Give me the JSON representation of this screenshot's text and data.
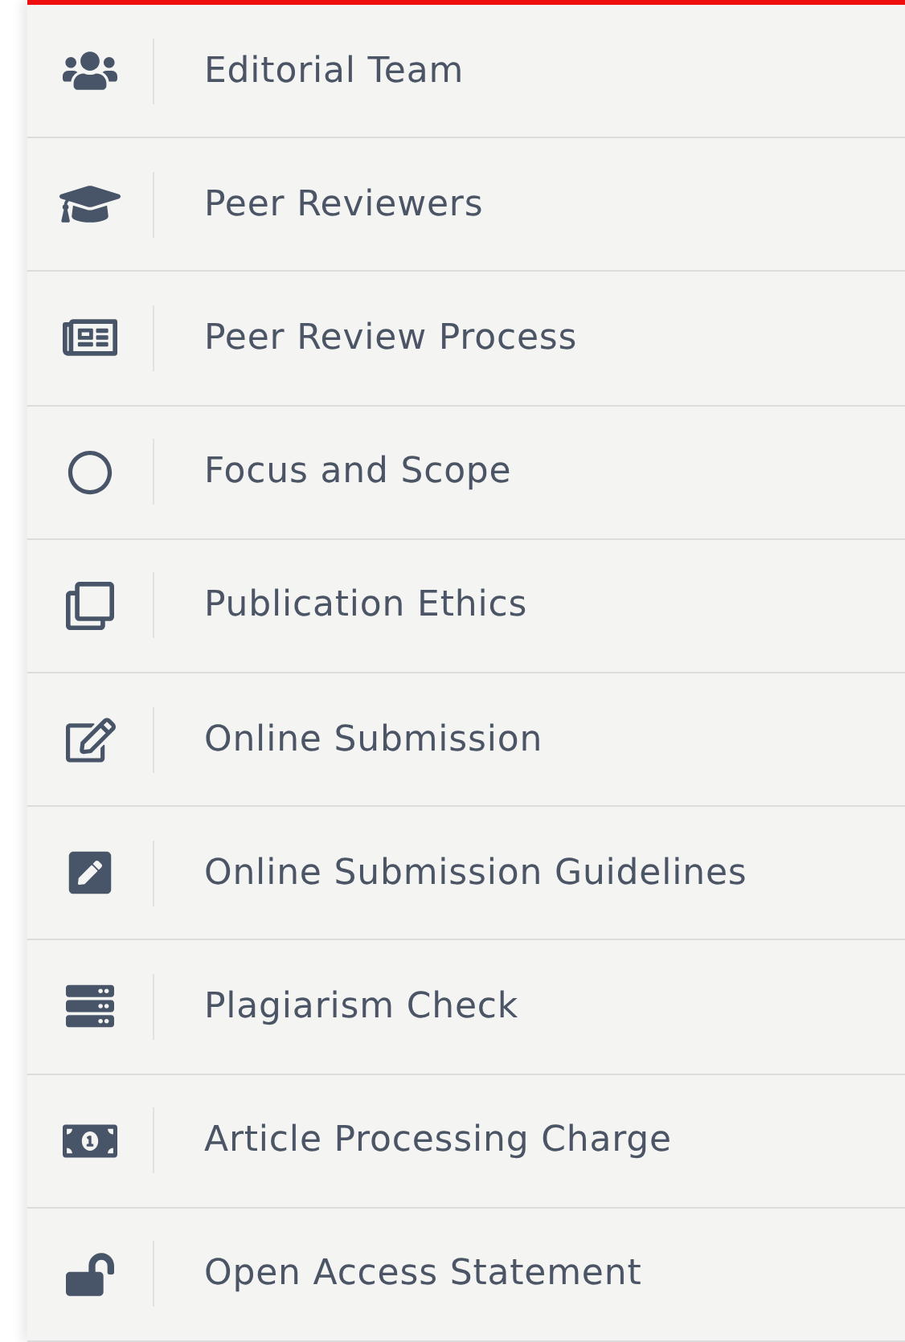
{
  "menu": [
    {
      "kind": "users",
      "label": "Editorial Team"
    },
    {
      "kind": "cap",
      "label": "Peer Reviewers"
    },
    {
      "kind": "newspaper",
      "label": "Peer Review Process"
    },
    {
      "kind": "circle",
      "label": "Focus and Scope"
    },
    {
      "kind": "copy",
      "label": "Publication Ethics"
    },
    {
      "kind": "edit",
      "label": "Online Submission"
    },
    {
      "kind": "pen",
      "label": "Online Submission Guidelines"
    },
    {
      "kind": "server",
      "label": "Plagiarism Check"
    },
    {
      "kind": "money",
      "label": "Article Processing Charge"
    },
    {
      "kind": "unlock",
      "label": "Open Access Statement"
    }
  ]
}
